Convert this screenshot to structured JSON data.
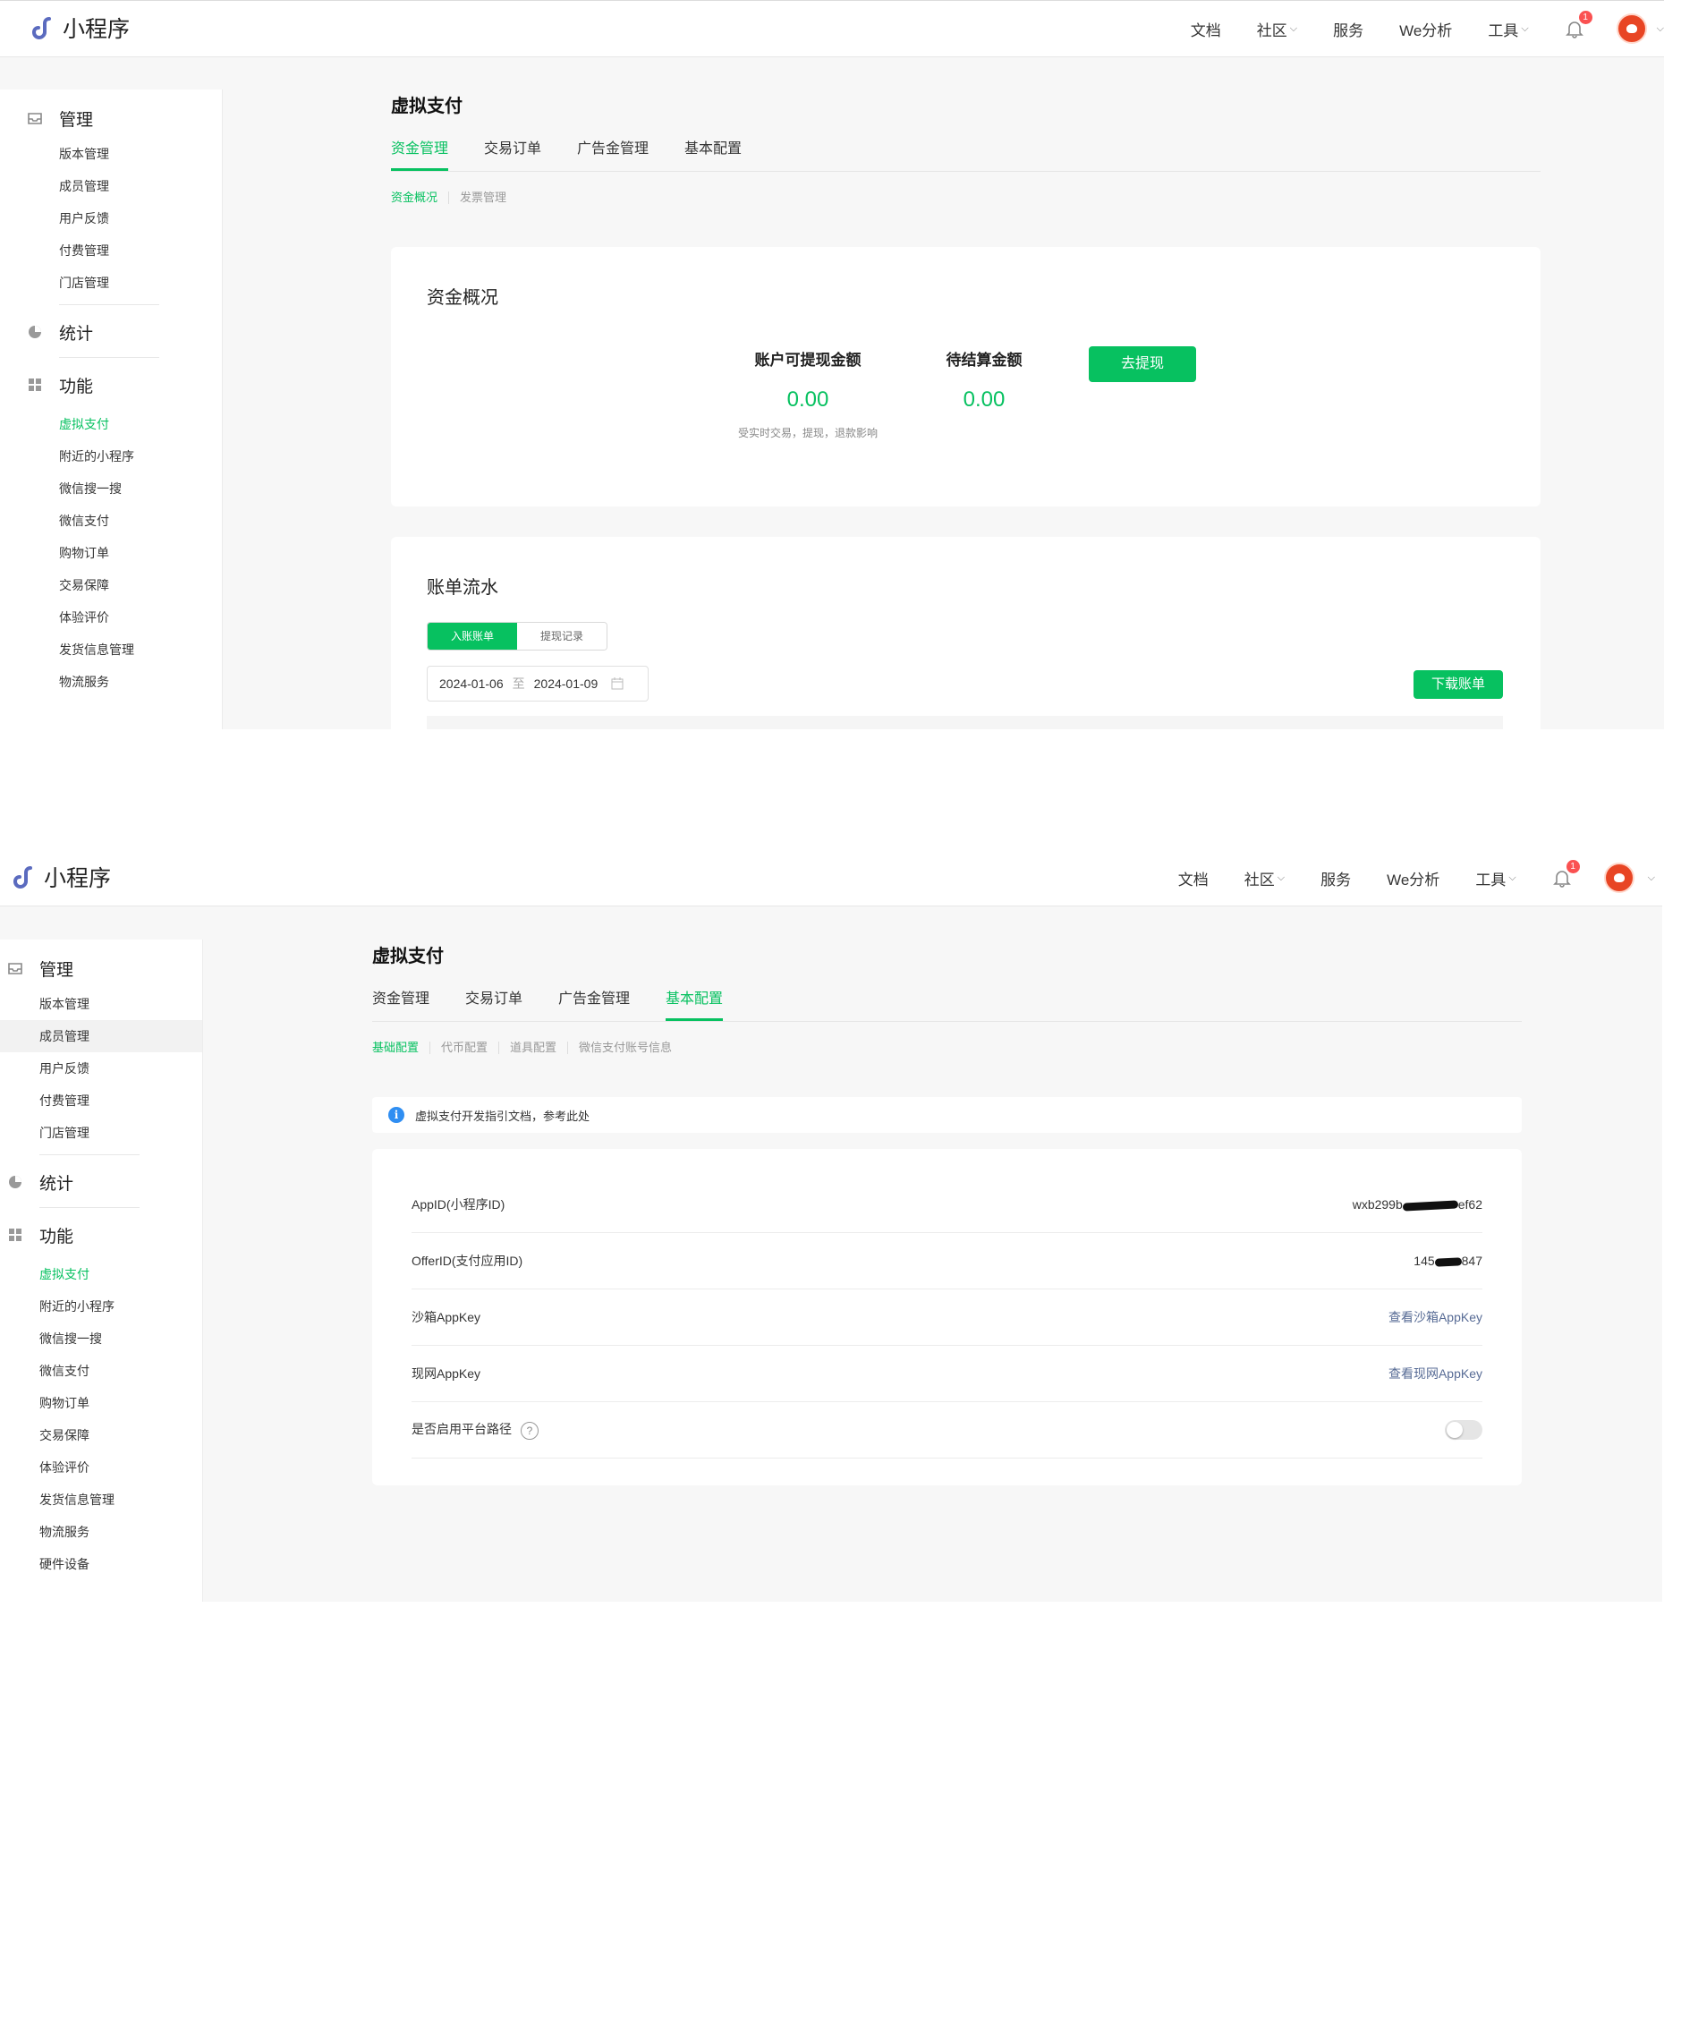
{
  "brand": "小程序",
  "topnav": {
    "docs": "文档",
    "community": "社区",
    "services": "服务",
    "analytics": "We分析",
    "tools": "工具",
    "notification_count": "1"
  },
  "sidebar": {
    "groups": [
      {
        "label": "管理",
        "items": [
          "版本管理",
          "成员管理",
          "用户反馈",
          "付费管理",
          "门店管理"
        ]
      },
      {
        "label": "统计",
        "items": []
      },
      {
        "label": "功能",
        "items": [
          "虚拟支付",
          "附近的小程序",
          "微信搜一搜",
          "微信支付",
          "购物订单",
          "交易保障",
          "体验评价",
          "发货信息管理",
          "物流服务",
          "硬件设备"
        ]
      }
    ]
  },
  "page_title": "虚拟支付",
  "tabs": [
    "资金管理",
    "交易订单",
    "广告金管理",
    "基本配置"
  ],
  "screen1": {
    "active_tab": "资金管理",
    "subtabs": [
      "资金概况",
      "发票管理"
    ],
    "overview": {
      "title": "资金概况",
      "withdrawable_label": "账户可提现金额",
      "withdrawable_value": "0.00",
      "withdrawable_note": "受实时交易，提现，退款影响",
      "pending_label": "待结算金额",
      "pending_value": "0.00",
      "withdraw_button": "去提现"
    },
    "ledger": {
      "title": "账单流水",
      "segments": [
        "入账账单",
        "提现记录"
      ],
      "date_start": "2024-01-06",
      "date_sep": "至",
      "date_end": "2024-01-09",
      "download_button": "下载账单"
    }
  },
  "screen2": {
    "active_tab": "基本配置",
    "subtabs": [
      "基础配置",
      "代币配置",
      "道具配置",
      "微信支付账号信息"
    ],
    "notice": "虚拟支付开发指引文档，参考此处",
    "config": [
      {
        "label": "AppID(小程序ID)",
        "value_prefix": "wxb299b",
        "value_suffix": "ef62"
      },
      {
        "label": "OfferID(支付应用ID)",
        "value_prefix": "145",
        "value_suffix": "847"
      },
      {
        "label": "沙箱AppKey",
        "link": "查看沙箱AppKey"
      },
      {
        "label": "现网AppKey",
        "link": "查看现网AppKey"
      },
      {
        "label": "是否启用平台路径",
        "help": "?",
        "toggle_on": false
      }
    ]
  },
  "colors": {
    "accent": "#07c160",
    "link": "#576b95",
    "badge": "#fa5151",
    "info": "#2f8ef2"
  }
}
